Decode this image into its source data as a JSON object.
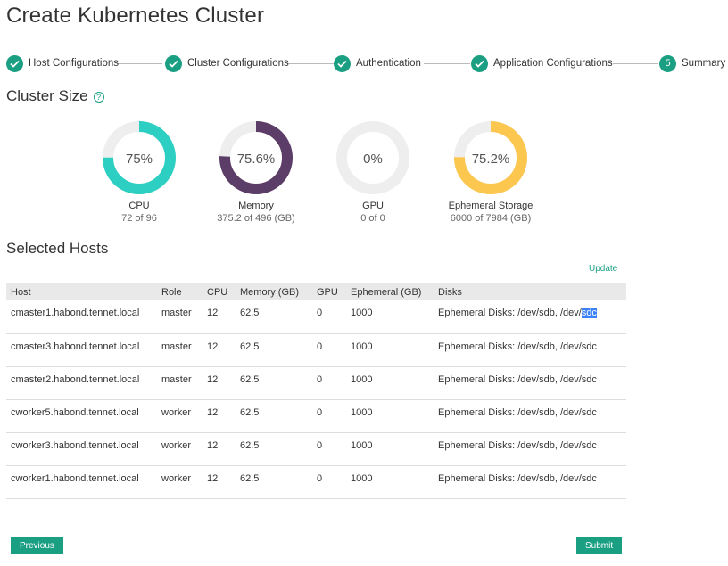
{
  "page": {
    "title": "Create Kubernetes Cluster"
  },
  "steps": [
    {
      "label": "Host Configurations",
      "state": "complete",
      "icon": "check-icon"
    },
    {
      "label": "Cluster Configurations",
      "state": "complete",
      "icon": "check-icon"
    },
    {
      "label": "Authentication",
      "state": "complete",
      "icon": "check-icon"
    },
    {
      "label": "Application Configurations",
      "state": "complete",
      "icon": "check-icon"
    },
    {
      "label": "Summary",
      "state": "current",
      "number": "5"
    }
  ],
  "cluster_size": {
    "title": "Cluster Size",
    "help_icon": "help-icon",
    "gauges": [
      {
        "value_text": "75%",
        "fraction": 0.75,
        "color": "#2ccfc2",
        "label": "CPU",
        "sub": "72 of 96"
      },
      {
        "value_text": "75.6%",
        "fraction": 0.756,
        "color": "#5b3d67",
        "label": "Memory",
        "sub": "375.2 of 496 (GB)"
      },
      {
        "value_text": "0%",
        "fraction": 0,
        "color": "#9e9e9e",
        "label": "GPU",
        "sub": "0 of 0"
      },
      {
        "value_text": "75.2%",
        "fraction": 0.752,
        "color": "#fcc74f",
        "label": "Ephemeral Storage",
        "sub": "6000 of 7984 (GB)"
      }
    ],
    "track_color": "#eeeeee"
  },
  "selected_hosts": {
    "title": "Selected Hosts",
    "update_label": "Update",
    "columns": [
      "Host",
      "Role",
      "CPU",
      "Memory (GB)",
      "GPU",
      "Ephemeral (GB)",
      "Disks"
    ],
    "rows": [
      [
        "cmaster1.habond.tennet.local",
        "master",
        "12",
        "62.5",
        "0",
        "1000",
        "Ephemeral Disks: /dev/sdb, /dev/sdc"
      ],
      [
        "cmaster3.habond.tennet.local",
        "master",
        "12",
        "62.5",
        "0",
        "1000",
        "Ephemeral Disks: /dev/sdb, /dev/sdc"
      ],
      [
        "cmaster2.habond.tennet.local",
        "master",
        "12",
        "62.5",
        "0",
        "1000",
        "Ephemeral Disks: /dev/sdb, /dev/sdc"
      ],
      [
        "cworker5.habond.tennet.local",
        "worker",
        "12",
        "62.5",
        "0",
        "1000",
        "Ephemeral Disks: /dev/sdb, /dev/sdc"
      ],
      [
        "cworker3.habond.tennet.local",
        "worker",
        "12",
        "62.5",
        "0",
        "1000",
        "Ephemeral Disks: /dev/sdb, /dev/sdc"
      ],
      [
        "cworker1.habond.tennet.local",
        "worker",
        "12",
        "62.5",
        "0",
        "1000",
        "Ephemeral Disks: /dev/sdb, /dev/sdc"
      ]
    ],
    "selected_text": "sdc"
  },
  "buttons": {
    "previous": "Previous",
    "submit": "Submit"
  },
  "colors": {
    "accent": "#1a9f82",
    "selection": "#3b82f6"
  }
}
